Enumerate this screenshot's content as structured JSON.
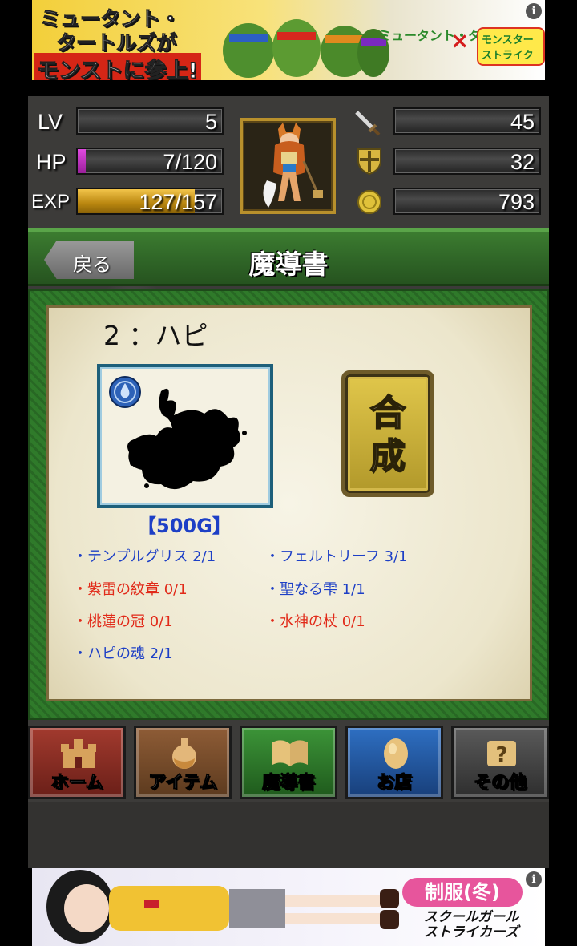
{
  "ads": {
    "top": {
      "line1": "ミュータント・",
      "line2": "タートルズが",
      "line3": "モンストに参上!",
      "logo_left": "ミュータント・タートルズ",
      "cross": "×",
      "logo_right": "モンスターストライク",
      "info": "i"
    },
    "bottom": {
      "badge": "制服(冬)",
      "logo": "スクールガール ストライカーズ",
      "info": "i"
    }
  },
  "status": {
    "lv_label": "LV",
    "lv_value": "5",
    "hp_label": "HP",
    "hp_value": "7/120",
    "hp_fraction": 0.058,
    "exp_label": "EXP",
    "exp_value": "127/157",
    "exp_fraction": 0.81,
    "attack_value": "45",
    "defense_value": "32",
    "gold_value": "793",
    "icons": [
      "sword-icon",
      "shield-icon",
      "coin-icon"
    ]
  },
  "header": {
    "back_label": "戻る",
    "title": "魔導書"
  },
  "entry": {
    "number_name": "2 ：ハピ",
    "price": "【500G】",
    "fuse_label": "合\n成",
    "materials": [
      {
        "text": "・テンプルグリス 2/1",
        "status": "ok"
      },
      {
        "text": "・フェルトリーフ 3/1",
        "status": "ok"
      },
      {
        "text": "・紫雷の紋章 0/1",
        "status": "missing"
      },
      {
        "text": "・聖なる雫 1/1",
        "status": "ok"
      },
      {
        "text": "・桃蓮の冠 0/1",
        "status": "missing"
      },
      {
        "text": "・水神の杖 0/1",
        "status": "missing"
      },
      {
        "text": "・ハピの魂 2/1",
        "status": "ok"
      }
    ]
  },
  "nav": {
    "home": "ホーム",
    "item": "アイテム",
    "grimoire": "魔導書",
    "shop": "お店",
    "other": "その他"
  },
  "colors": {
    "header_green": "#2e6326",
    "panel_green": "#2f7a2a",
    "parchment": "#f0ecd8",
    "material_ok": "#1d3fc6",
    "material_missing": "#e12a19",
    "hp_bar": "#b42db4",
    "exp_bar": "#d8a11b",
    "nav_home": "#8a2a22",
    "nav_item": "#7a4c2c",
    "nav_grimoire": "#2e7a2a",
    "nav_shop": "#22539c",
    "nav_other": "#4a4a4a"
  }
}
